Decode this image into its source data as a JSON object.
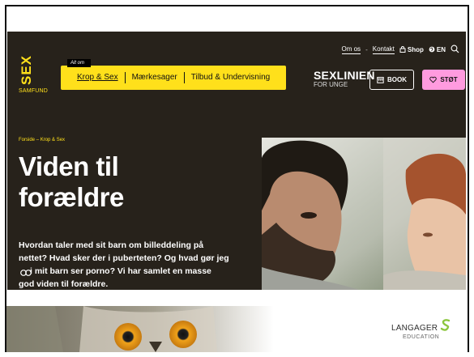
{
  "header": {
    "logo_letters": "SEX",
    "logo_sub": "SAMFUND",
    "top_links": {
      "about": "Om os",
      "contact": "Kontakt",
      "shop": "Shop",
      "lang": "EN"
    },
    "nav_tag": "Alt om",
    "nav_items": [
      {
        "label": "Krop & Sex"
      },
      {
        "label": "Mærkesager"
      },
      {
        "label": "Tilbud & Undervisning"
      }
    ],
    "sexlinien": {
      "title": "SEXLINIEN",
      "subtitle": "FOR UNGE"
    },
    "book_label": "BOOK",
    "donate_label": "STØT"
  },
  "hero": {
    "breadcrumb": {
      "home": "Forside",
      "sep": "–",
      "current": "Krop & Sex"
    },
    "title_line1": "Viden til",
    "title_line2": "forældre",
    "text_line1": "Hvordan taler med sit barn om billeddeling på",
    "text_line2": "nettet? Hvad sker der i puberteten? Og hvad gør jeg",
    "text_line3": "i mit barn ser porno? Vi har samlet en masse",
    "text_line4": "god viden til forældre."
  },
  "ad": {
    "brand": "LANGAGER",
    "brand_sub": "EDUCATION"
  },
  "colors": {
    "site_bg": "#27221b",
    "accent_yellow": "#ffe01b",
    "accent_pink": "#ff9bdf"
  },
  "icons": [
    "globe-icon",
    "search-icon",
    "calendar-icon",
    "heart-icon",
    "shop-icon",
    "cookie-icon"
  ]
}
